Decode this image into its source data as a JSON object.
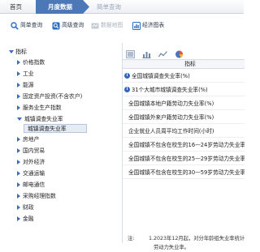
{
  "nav": {
    "home": "首页",
    "monthly": "月度数据",
    "quick": "简单查询"
  },
  "toolbar": {
    "simple": "简单查询",
    "advanced": "高级查询",
    "map": "数据地图",
    "economic": "经济图表"
  },
  "tree": {
    "root": "指标",
    "items": [
      "价格指数",
      "工业",
      "能源",
      "固定资产投资(不含农户)",
      "服务业生产指数",
      "城镇调查失业率",
      "房地产",
      "国内贸易",
      "对外经济",
      "交通运输",
      "邮电通信",
      "采购经理指数",
      "财政",
      "金融"
    ],
    "selected_child": "城镇调查失业率"
  },
  "panel": {
    "header": "指标",
    "rows": [
      {
        "text": "全国城镇调查失业率(%)",
        "info": true
      },
      {
        "text": "31个大城市城镇调查失业率(%)",
        "info": true
      },
      {
        "text": "全国城镇本地户籍劳动力失业率(%)",
        "info": false
      },
      {
        "text": "全国城镇外来户籍劳动力失业率(%)",
        "info": false
      },
      {
        "text": "企业就业人员周平均工作时间(小时)",
        "info": false
      },
      {
        "text": "全国城镇不包含在校生的16—24岁劳动力失业率(",
        "info": false
      },
      {
        "text": "全国城镇不包含在校生的25—29岁劳动力失业率(",
        "info": false
      },
      {
        "text": "全国城镇不包含在校生的30—59岁劳动力失业率(",
        "info": false
      }
    ],
    "note_label": "注:",
    "note_line1": "1.2023年12月起，对分年龄组失业率统计",
    "note_line2": "劳动力失业率。"
  },
  "colors": {
    "nav_active": "#4d78b8",
    "accent": "#3e6db5",
    "selected_bg": "#e4ecf6"
  }
}
